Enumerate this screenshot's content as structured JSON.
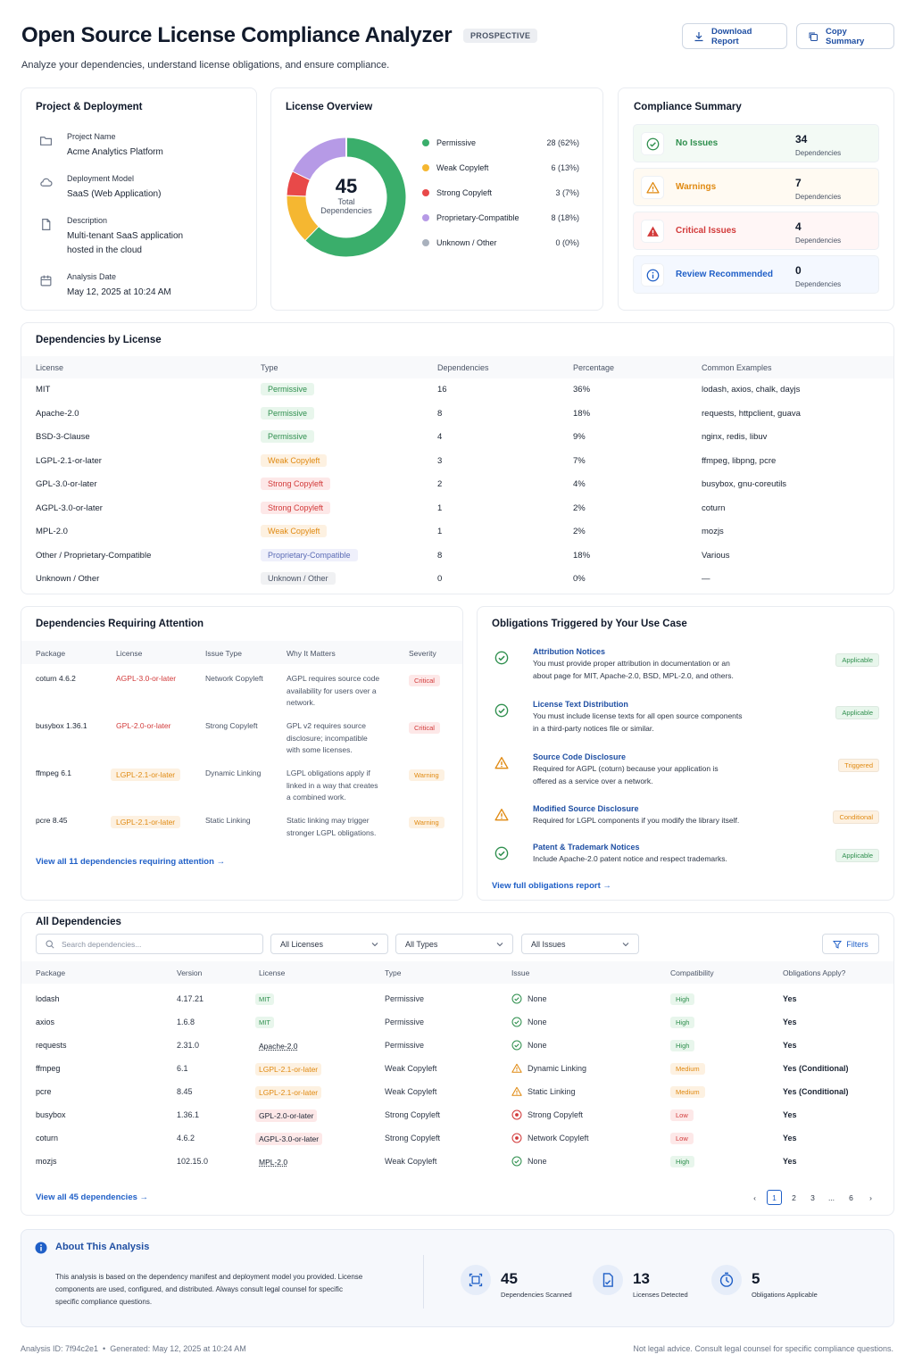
{
  "header": {
    "title": "Open Source License Compliance Analyzer",
    "tag": "PROSPECTIVE",
    "subtitle": "Analyze your dependencies, understand license obligations, and ensure compliance.",
    "download": "Download Report",
    "copy": "Copy Summary"
  },
  "project": {
    "title": "Project & Deployment",
    "items": [
      {
        "label": "Project Name",
        "value": "Acme Analytics Platform",
        "icon": "folder-icon"
      },
      {
        "label": "Deployment Model",
        "value": "SaaS (Web Application)",
        "icon": "cloud-icon"
      },
      {
        "label": "Description",
        "value": "Multi-tenant SaaS application hosted in the cloud",
        "icon": "document-icon"
      },
      {
        "label": "Analysis Date",
        "value": "May 12, 2025 at 10:24 AM",
        "icon": "calendar-icon"
      }
    ]
  },
  "overview": {
    "title": "License Overview",
    "total": "45",
    "total_label1": "Total",
    "total_label2": "Dependencies",
    "legend": [
      {
        "name": "Permissive",
        "value": "28 (62%)",
        "color": "#3aae6b",
        "count": 28
      },
      {
        "name": "Weak Copyleft",
        "value": "6 (13%)",
        "color": "#f5b731",
        "count": 6
      },
      {
        "name": "Strong Copyleft",
        "value": "3 (7%)",
        "color": "#e84949",
        "count": 3
      },
      {
        "name": "Proprietary-Compatible",
        "value": "8 (18%)",
        "color": "#b69ae6",
        "count": 8
      },
      {
        "name": "Unknown / Other",
        "value": "0 (0%)",
        "color": "#a9b1bd",
        "count": 0
      }
    ]
  },
  "summary": {
    "title": "Compliance Summary",
    "items": [
      {
        "label": "No Issues",
        "count": "34",
        "sub": "Dependencies",
        "color": "#2f8f4e",
        "bg": "#f3faf5",
        "icon": "check-circle-icon"
      },
      {
        "label": "Warnings",
        "count": "7",
        "sub": "Dependencies",
        "color": "#e08a12",
        "bg": "#fffaf2",
        "icon": "warning-icon"
      },
      {
        "label": "Critical Issues",
        "count": "4",
        "sub": "Dependencies",
        "color": "#d23a3a",
        "bg": "#fff6f6",
        "icon": "critical-icon"
      },
      {
        "label": "Review Recommended",
        "count": "0",
        "sub": "Dependencies",
        "color": "#1f5fc7",
        "bg": "#f4f8ff",
        "icon": "info-icon"
      }
    ]
  },
  "bylicense": {
    "title": "Dependencies by License",
    "headers": [
      "License",
      "Type",
      "Dependencies",
      "Percentage",
      "Common Examples"
    ],
    "rows": [
      {
        "license": "MIT",
        "type": "Permissive",
        "cls": "p-perm",
        "deps": "16",
        "pct": "36%",
        "ex": "lodash, axios, chalk, dayjs"
      },
      {
        "license": "Apache-2.0",
        "type": "Permissive",
        "cls": "p-perm",
        "deps": "8",
        "pct": "18%",
        "ex": "requests, httpclient, guava"
      },
      {
        "license": "BSD-3-Clause",
        "type": "Permissive",
        "cls": "p-perm",
        "deps": "4",
        "pct": "9%",
        "ex": "nginx, redis, libuv"
      },
      {
        "license": "LGPL-2.1-or-later",
        "type": "Weak Copyleft",
        "cls": "p-weak",
        "deps": "3",
        "pct": "7%",
        "ex": "ffmpeg, libpng, pcre"
      },
      {
        "license": "GPL-3.0-or-later",
        "type": "Strong Copyleft",
        "cls": "p-strong",
        "deps": "2",
        "pct": "4%",
        "ex": "busybox, gnu-coreutils"
      },
      {
        "license": "AGPL-3.0-or-later",
        "type": "Strong Copyleft",
        "cls": "p-strong",
        "deps": "1",
        "pct": "2%",
        "ex": "coturn"
      },
      {
        "license": "MPL-2.0",
        "type": "Weak Copyleft",
        "cls": "p-weak",
        "deps": "1",
        "pct": "2%",
        "ex": "mozjs"
      },
      {
        "license": "Other / Proprietary-Compatible",
        "type": "Proprietary-Compatible",
        "cls": "p-prop",
        "deps": "8",
        "pct": "18%",
        "ex": "Various"
      },
      {
        "license": "Unknown / Other",
        "type": "Unknown / Other",
        "cls": "p-unk",
        "deps": "0",
        "pct": "0%",
        "ex": "—"
      }
    ]
  },
  "attention": {
    "title": "Dependencies Requiring Attention",
    "headers": [
      "Package",
      "License",
      "Issue Type",
      "Why It Matters",
      "Severity"
    ],
    "rows": [
      {
        "pkg": "coturn 4.6.2",
        "lic": "AGPL-3.0-or-later",
        "liccls": "strong",
        "issue": "Network Copyleft",
        "why": [
          "AGPL requires source code",
          "availability for users over a",
          "network."
        ],
        "sev": "Critical",
        "sevcls": "p-strong"
      },
      {
        "pkg": "busybox 1.36.1",
        "lic": "GPL-2.0-or-later",
        "liccls": "strong",
        "issue": "Strong Copyleft",
        "why": [
          "GPL v2 requires source",
          "disclosure; incompatible",
          "with some licenses."
        ],
        "sev": "Critical",
        "sevcls": "p-strong"
      },
      {
        "pkg": "ffmpeg 6.1",
        "lic": "LGPL-2.1-or-later",
        "liccls": "weak",
        "issue": "Dynamic Linking",
        "why": [
          "LGPL obligations apply if",
          "linked in a way that creates",
          "a combined work."
        ],
        "sev": "Warning",
        "sevcls": "p-weak"
      },
      {
        "pkg": "pcre 8.45",
        "lic": "LGPL-2.1-or-later",
        "liccls": "weak",
        "issue": "Static Linking",
        "why": [
          "Static linking may trigger",
          "stronger LGPL obligations."
        ],
        "sev": "Warning",
        "sevcls": "p-weak"
      }
    ],
    "link": "View all 11 dependencies requiring attention"
  },
  "obligations": {
    "title": "Obligations Triggered by Your Use Case",
    "items": [
      {
        "title": "Attribution Notices",
        "desc": [
          "You must provide proper attribution in documentation or an",
          "about page for MIT, Apache-2.0, BSD, MPL-2.0, and others."
        ],
        "status": "Applicable",
        "cls": "p-perm",
        "icon": "check-circle-icon"
      },
      {
        "title": "License Text Distribution",
        "desc": [
          "You must include license texts for all open source components",
          "in a third-party notices file or similar."
        ],
        "status": "Applicable",
        "cls": "p-perm",
        "icon": "check-circle-icon"
      },
      {
        "title": "Source Code Disclosure",
        "desc": [
          "Required for AGPL (coturn) because your application is",
          "offered as a service over a network."
        ],
        "status": "Triggered",
        "cls": "p-weak",
        "icon": "warning-icon"
      },
      {
        "title": "Modified Source Disclosure",
        "desc": [
          "Required for LGPL components if you modify the library itself."
        ],
        "status": "Conditional",
        "cls": "p-weak",
        "icon": "warning-icon"
      },
      {
        "title": "Patent & Trademark Notices",
        "desc": [
          "Include Apache-2.0 patent notice and respect trademarks."
        ],
        "status": "Applicable",
        "cls": "p-perm",
        "icon": "check-circle-icon"
      }
    ],
    "link": "View full obligations report"
  },
  "all": {
    "title": "All Dependencies",
    "search_placeholder": "Search dependencies...",
    "filters": [
      "All Licenses",
      "All Types",
      "All Issues"
    ],
    "filters_btn": "Filters",
    "headers": [
      "Package",
      "Version",
      "License",
      "Type",
      "Issue",
      "Compatibility",
      "Obligations Apply?"
    ],
    "rows": [
      {
        "pkg": "lodash",
        "ver": "4.17.21",
        "lic": "MIT",
        "liccls": "mit",
        "type": "Permissive",
        "issue": "None",
        "icls": "ok",
        "compat": "High",
        "ccls": "p-perm",
        "obl": "Yes"
      },
      {
        "pkg": "axios",
        "ver": "1.6.8",
        "lic": "MIT",
        "liccls": "mit",
        "type": "Permissive",
        "issue": "None",
        "icls": "ok",
        "compat": "High",
        "ccls": "p-perm",
        "obl": "Yes"
      },
      {
        "pkg": "requests",
        "ver": "2.31.0",
        "lic": "Apache-2.0",
        "liccls": "plain",
        "type": "Permissive",
        "issue": "None",
        "icls": "ok",
        "compat": "High",
        "ccls": "p-perm",
        "obl": "Yes"
      },
      {
        "pkg": "ffmpeg",
        "ver": "6.1",
        "lic": "LGPL-2.1-or-later",
        "liccls": "weak",
        "type": "Weak Copyleft",
        "issue": "Dynamic Linking",
        "icls": "warn",
        "compat": "Medium",
        "ccls": "p-weak",
        "obl": "Yes (Conditional)"
      },
      {
        "pkg": "pcre",
        "ver": "8.45",
        "lic": "LGPL-2.1-or-later",
        "liccls": "weak",
        "type": "Weak Copyleft",
        "issue": "Static Linking",
        "icls": "warn",
        "compat": "Medium",
        "ccls": "p-weak",
        "obl": "Yes (Conditional)"
      },
      {
        "pkg": "busybox",
        "ver": "1.36.1",
        "lic": "GPL-2.0-or-later",
        "liccls": "strongb",
        "type": "Strong Copyleft",
        "issue": "Strong Copyleft",
        "icls": "crit",
        "compat": "Low",
        "ccls": "p-strong",
        "obl": "Yes"
      },
      {
        "pkg": "coturn",
        "ver": "4.6.2",
        "lic": "AGPL-3.0-or-later",
        "liccls": "strongb",
        "type": "Strong Copyleft",
        "issue": "Network Copyleft",
        "icls": "crit",
        "compat": "Low",
        "ccls": "p-strong",
        "obl": "Yes"
      },
      {
        "pkg": "mozjs",
        "ver": "102.15.0",
        "lic": "MPL-2.0",
        "liccls": "plain",
        "type": "Weak Copyleft",
        "issue": "None",
        "icls": "ok",
        "compat": "High",
        "ccls": "p-perm",
        "obl": "Yes"
      }
    ],
    "link": "View all 45 dependencies",
    "pages": [
      "1",
      "2",
      "3",
      "...",
      "6"
    ]
  },
  "about": {
    "title": "About This Analysis",
    "text": [
      "This analysis is based on the dependency manifest and deployment model you provided. License",
      "components are used, configured, and distributed. Always consult legal counsel for specific",
      "specific compliance questions."
    ],
    "stats": [
      {
        "value": "45",
        "label": "Dependencies Scanned",
        "icon": "scan-icon"
      },
      {
        "value": "13",
        "label": "Licenses Detected",
        "icon": "license-icon"
      },
      {
        "value": "5",
        "label": "Obligations Applicable",
        "icon": "obligation-icon"
      }
    ]
  },
  "footer": {
    "left": "Analysis ID: 7f94c2e1  •  Generated: May 12, 2025 at 10:24 AM",
    "right": "Not legal advice. Consult legal counsel for specific compliance questions."
  }
}
